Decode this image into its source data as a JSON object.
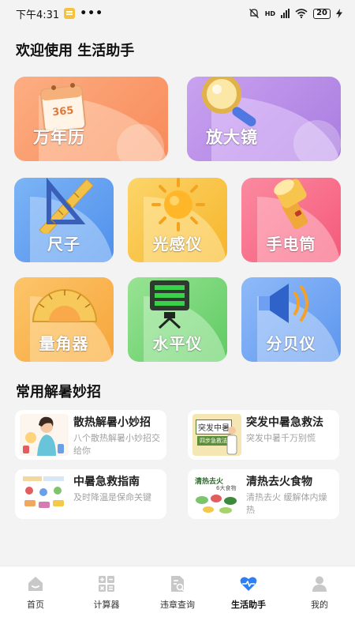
{
  "status_bar": {
    "time": "下午4:31",
    "dots": "•••",
    "network": "HD",
    "battery": "20"
  },
  "welcome": {
    "title": "欢迎使用 生活助手"
  },
  "tools": [
    {
      "label": "万年历",
      "icon": "calendar-icon",
      "color": "#fb9a6a"
    },
    {
      "label": "放大镜",
      "icon": "magnifier-icon",
      "color": "#b98be6"
    },
    {
      "label": "尺子",
      "icon": "ruler-icon",
      "color": "#5b9ff0"
    },
    {
      "label": "光感仪",
      "icon": "sun-icon",
      "color": "#f9c23a"
    },
    {
      "label": "手电筒",
      "icon": "flashlight-icon",
      "color": "#f86b88"
    },
    {
      "label": "量角器",
      "icon": "protractor-icon",
      "color": "#f9b544"
    },
    {
      "label": "水平仪",
      "icon": "level-icon",
      "color": "#7dd87b"
    },
    {
      "label": "分贝仪",
      "icon": "speaker-icon",
      "color": "#6ba7f5"
    }
  ],
  "tips_section": {
    "title": "常用解暑妙招"
  },
  "tips": [
    {
      "title": "散热解暑小妙招",
      "desc": "八个散热解暑小妙招交给你"
    },
    {
      "title": "突发中暑急救法",
      "desc": "突发中暑千万别慌",
      "thumb_label": "突发中暑",
      "thumb_sub": "四步急救法"
    },
    {
      "title": "中暑急救指南",
      "desc": "及时降温是保命关键"
    },
    {
      "title": "清热去火食物",
      "desc": "清热去火 缓解体内燥热",
      "thumb_label": "清热去火",
      "thumb_sub": "6大食物"
    }
  ],
  "nav": [
    {
      "label": "首页",
      "icon": "home-icon",
      "active": false
    },
    {
      "label": "计算器",
      "icon": "calculator-icon",
      "active": false
    },
    {
      "label": "违章查询",
      "icon": "document-search-icon",
      "active": false
    },
    {
      "label": "生活助手",
      "icon": "heart-pulse-icon",
      "active": true
    },
    {
      "label": "我的",
      "icon": "user-icon",
      "active": false
    }
  ],
  "colors": {
    "accent": "#2e7ff5",
    "background": "#f3f3f4"
  }
}
